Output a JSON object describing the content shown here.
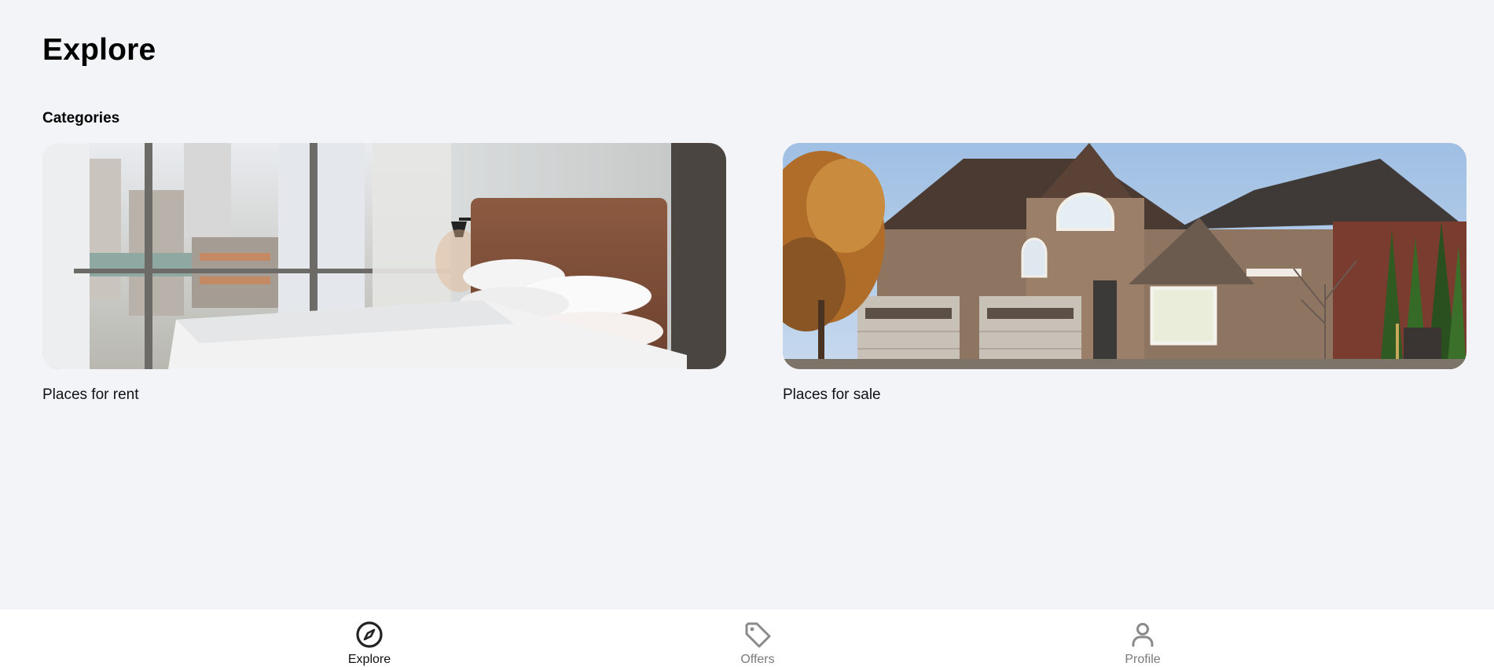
{
  "header": {
    "title": "Explore"
  },
  "categories": {
    "heading": "Categories",
    "items": [
      {
        "label": "Places for rent",
        "image": "bedroom-photo"
      },
      {
        "label": "Places for sale",
        "image": "house-photo"
      }
    ]
  },
  "bottom_nav": {
    "items": [
      {
        "label": "Explore",
        "icon": "compass-icon",
        "active": true
      },
      {
        "label": "Offers",
        "icon": "tag-icon",
        "active": false
      },
      {
        "label": "Profile",
        "icon": "person-icon",
        "active": false
      }
    ]
  },
  "colors": {
    "background": "#f2f4f8",
    "nav_background": "#ffffff",
    "active": "#111111",
    "inactive": "#7a7a7a"
  }
}
